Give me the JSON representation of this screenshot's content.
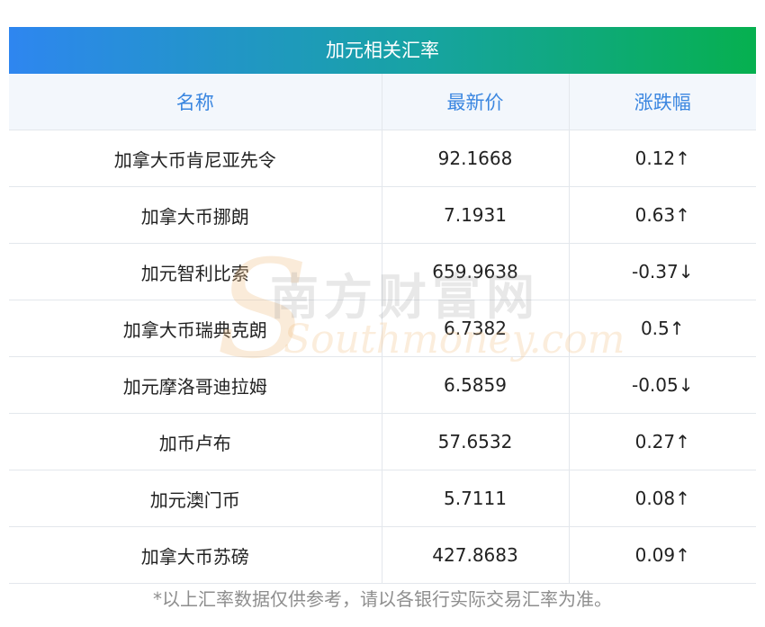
{
  "title": "加元相关汇率",
  "headers": {
    "name": "名称",
    "price": "最新价",
    "change": "涨跌幅"
  },
  "rows": [
    {
      "name": "加拿大币肯尼亚先令",
      "price": "92.1668",
      "change": "0.12↑",
      "direction": "up"
    },
    {
      "name": "加拿大币挪朗",
      "price": "7.1931",
      "change": "0.63↑",
      "direction": "up"
    },
    {
      "name": "加元智利比索",
      "price": "659.9638",
      "change": "-0.37↓",
      "direction": "down"
    },
    {
      "name": "加拿大币瑞典克朗",
      "price": "6.7382",
      "change": "0.5↑",
      "direction": "up"
    },
    {
      "name": "加元摩洛哥迪拉姆",
      "price": "6.5859",
      "change": "-0.05↓",
      "direction": "down"
    },
    {
      "name": "加币卢布",
      "price": "57.6532",
      "change": "0.27↑",
      "direction": "up"
    },
    {
      "name": "加元澳门币",
      "price": "5.7111",
      "change": "0.08↑",
      "direction": "up"
    },
    {
      "name": "加拿大币苏磅",
      "price": "427.8683",
      "change": "0.09↑",
      "direction": "up"
    }
  ],
  "footnote": "*以上汇率数据仅供参考，请以各银行实际交易汇率为准。",
  "watermark": {
    "chinese": "南方财富网",
    "english": "Southmoney.com"
  },
  "colors": {
    "up": "#e8130f",
    "down": "#138a10",
    "header_text": "#3a86e0"
  }
}
